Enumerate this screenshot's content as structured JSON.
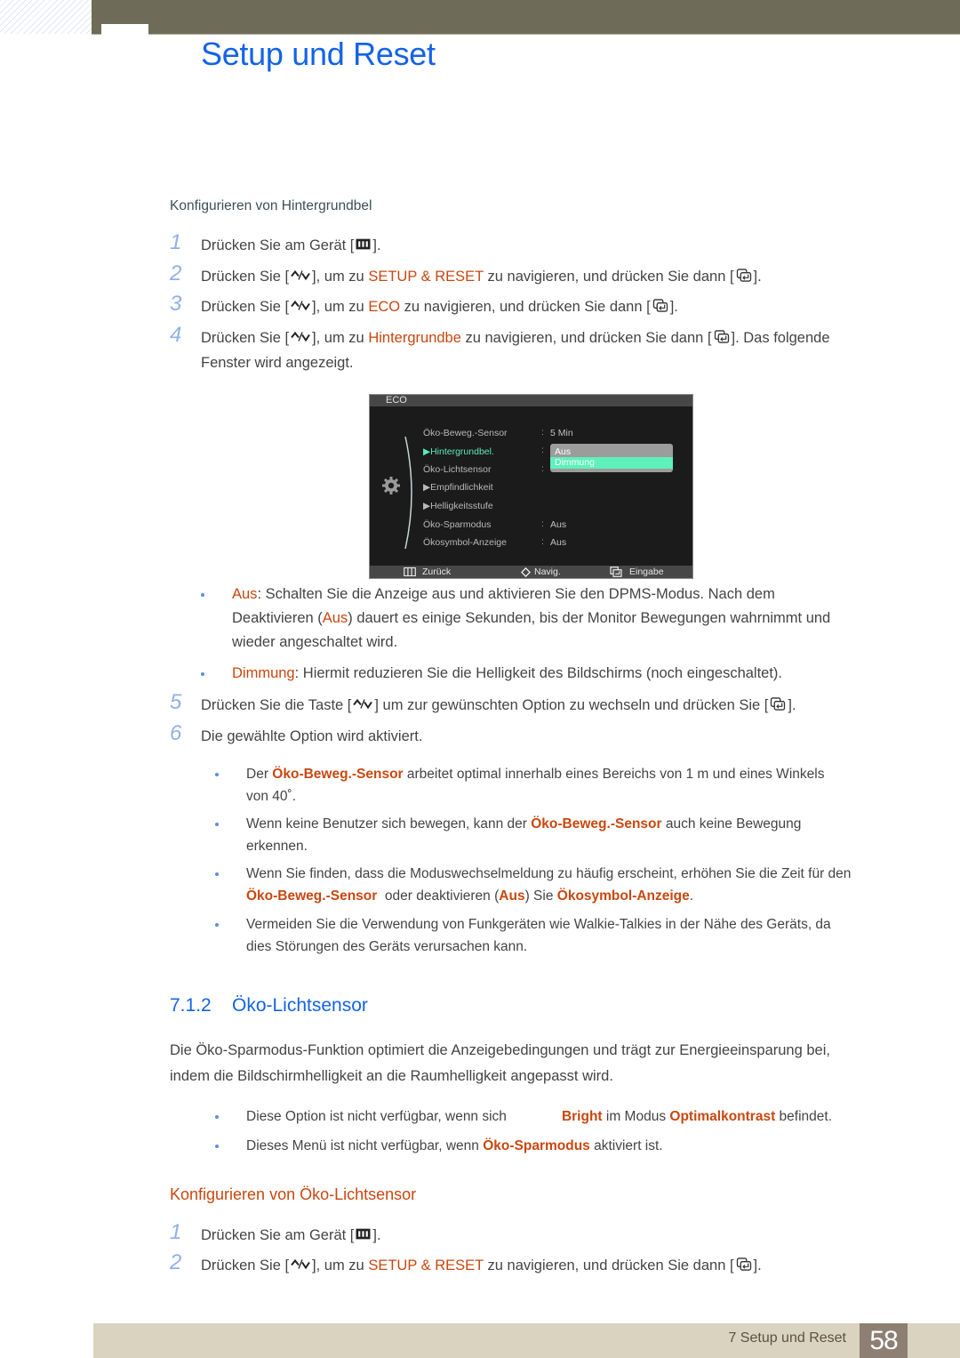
{
  "header": {
    "chapter_title": "Setup und Reset"
  },
  "section_a": {
    "subheading": "Konfigurieren von Hintergrundbel",
    "steps": [
      {
        "num": "1",
        "pre": "Drücken Sie am Gerät [",
        "key": "menu-key",
        "post": "]."
      },
      {
        "num": "2",
        "pre": "Drücken Sie [",
        "key": "up-down-key",
        "mid": "], um zu ",
        "hl": "SETUP & RESET",
        "mid2": " zu navigieren, und drücken Sie dann [",
        "key2": "enter-key",
        "post": "]."
      },
      {
        "num": "3",
        "pre": "Drücken Sie [",
        "key": "up-down-key",
        "mid": "], um zu ",
        "hl": "ECO",
        "mid2": " zu navigieren, und drücken Sie dann [",
        "key2": "enter-key",
        "post": "]."
      },
      {
        "num": "4",
        "pre": "Drücken Sie [",
        "key": "up-down-key",
        "mid": "], um zu ",
        "hl": "Hintergrundbe",
        "mid2": " zu navigieren, und drücken Sie dann [",
        "key2": "enter-key",
        "post": "]. Das folgende",
        "line2": "Fenster wird angezeigt."
      }
    ]
  },
  "osd": {
    "title": "ECO",
    "rows": [
      {
        "label": "Öko-Beweg.-Sensor",
        "value": "5 Min",
        "arrow": false,
        "active": false
      },
      {
        "label": "Hintergrundbel.",
        "value": "",
        "arrow": true,
        "active": true
      },
      {
        "label": "Öko-Lichtsensor",
        "value": "",
        "arrow": false,
        "active": false
      },
      {
        "label": "Empfindlichkeit",
        "value": "",
        "arrow": true,
        "active": false
      },
      {
        "label": "Helligkeitsstufe",
        "value": "",
        "arrow": true,
        "active": false
      },
      {
        "label": "Öko-Sparmodus",
        "value": "Aus",
        "arrow": false,
        "active": false
      },
      {
        "label": "Ökosymbol-Anzeige",
        "value": "Aus",
        "arrow": false,
        "active": false
      }
    ],
    "dropdown": {
      "options": [
        "Aus",
        "Dimmung"
      ],
      "selected": "Dimmung"
    },
    "footer": {
      "back": "Zurück",
      "nav": "Navig.",
      "enter": "Eingabe"
    },
    "colon": ":",
    "arrow_glyph": "▶"
  },
  "options_bullets": [
    {
      "term": "Aus",
      "text1": ": Schalten Sie die Anzeige aus und aktivieren Sie den DPMS-Modus. Nach dem",
      "line2_pre": "Deaktivieren (",
      "line2_hl": "Aus",
      "line2_post": ") dauert es einige Sekunden, bis der Monitor Bewegungen wahrnimmt und",
      "line3": "wieder angeschaltet wird."
    },
    {
      "term": "Dimmung",
      "text1": ": Hiermit reduzieren Sie die Helligkeit des Bildschirms (noch eingeschaltet)."
    }
  ],
  "steps_b": [
    {
      "num": "5",
      "pre": "Drücken Sie die Taste [",
      "mid": "] um zur gewünschten Option zu wechseln und drücken Sie [",
      "post": "]."
    },
    {
      "num": "6",
      "text": "Die gewählte Option wird aktiviert."
    }
  ],
  "notes": [
    {
      "pre": "Der ",
      "hl": "Öko-Beweg.-Sensor",
      "post": " arbeitet optimal innerhalb eines Bereichs von 1 m und eines Winkels",
      "line2": "von 40˚."
    },
    {
      "pre": "Wenn keine Benutzer sich bewegen, kann der ",
      "hl": "Öko-Beweg.-Sensor",
      "post": " auch keine Bewegung",
      "line2": "erkennen."
    },
    {
      "line1": "Wenn Sie finden, dass die Moduswechselmeldung zu häufig erscheint, erhöhen Sie die Zeit für den",
      "l2_hl1": "Öko-Beweg.-Sensor",
      "l2_mid": "  oder deaktivieren (",
      "l2_hl2": "Aus",
      "l2_mid2": ") Sie ",
      "l2_hl3": "Ökosymbol-Anzeige",
      "l2_post": "."
    },
    {
      "line1": "Vermeiden Sie die Verwendung von Funkgeräten wie Walkie-Talkies in der Nähe des Geräts, da",
      "line2": "dies Störungen des Geräts verursachen kann."
    }
  ],
  "section_b": {
    "number": "7.1.2",
    "title": "Öko-Lichtsensor",
    "paragraph_l1": "Die Öko-Sparmodus-Funktion optimiert die Anzeigebedingungen und trägt zur Energieeinsparung bei,",
    "paragraph_l2": "indem die Bildschirmhelligkeit an die Raumhelligkeit angepasst wird.",
    "notes": [
      {
        "pre": "Diese Option ist nicht verfügbar, wenn sich",
        "hl1": "Bright",
        "mid": " im Modus ",
        "hl2": "Optimalkontrast",
        "post": " befindet."
      },
      {
        "pre": "Dieses Menü ist nicht verfügbar, wenn ",
        "hl1": "Öko-Sparmodus",
        "post": " aktiviert ist."
      }
    ],
    "subheading": "Konfigurieren von Öko-Lichtsensor",
    "steps": [
      {
        "num": "1",
        "pre": "Drücken Sie am Gerät [",
        "post": "]."
      },
      {
        "num": "2",
        "pre": "Drücken Sie [",
        "mid": "], um zu ",
        "hl": "SETUP & RESET",
        "mid2": " zu navigieren, und drücken Sie dann [",
        "post": "]."
      }
    ]
  },
  "footer": {
    "chapter_label": "7 Setup und Reset",
    "page_number": "58"
  }
}
